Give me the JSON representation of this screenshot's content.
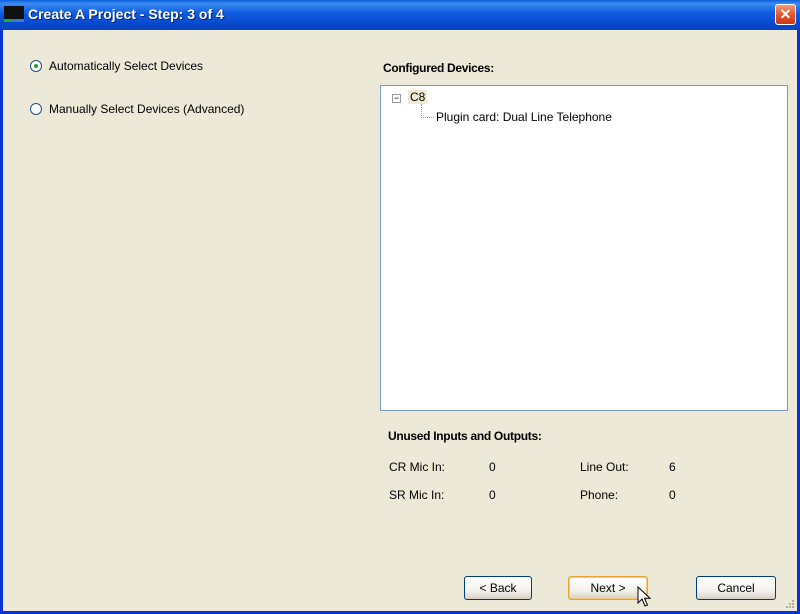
{
  "window": {
    "title": "Create A Project - Step: 3 of 4",
    "close_label": "✕"
  },
  "options": {
    "auto_label": "Automatically Select Devices",
    "manual_label": "Manually Select Devices (Advanced)",
    "selected": "auto"
  },
  "configured": {
    "heading": "Configured Devices:",
    "tree": {
      "root_label": "C8",
      "expander": "−",
      "children": [
        "Plugin card: Dual Line Telephone"
      ]
    }
  },
  "unused": {
    "heading": "Unused Inputs and Outputs:",
    "cr_mic_in_label": "CR Mic In:",
    "cr_mic_in_value": "0",
    "sr_mic_in_label": "SR Mic In:",
    "sr_mic_in_value": "0",
    "line_out_label": "Line Out:",
    "line_out_value": "6",
    "phone_label": "Phone:",
    "phone_value": "0"
  },
  "buttons": {
    "back": "< Back",
    "next": "Next >",
    "cancel": "Cancel"
  },
  "colors": {
    "titlebar": "#0a43c0",
    "window_bg": "#ece9d8",
    "radio_dot": "#21a121",
    "close_button": "#e5562d"
  }
}
